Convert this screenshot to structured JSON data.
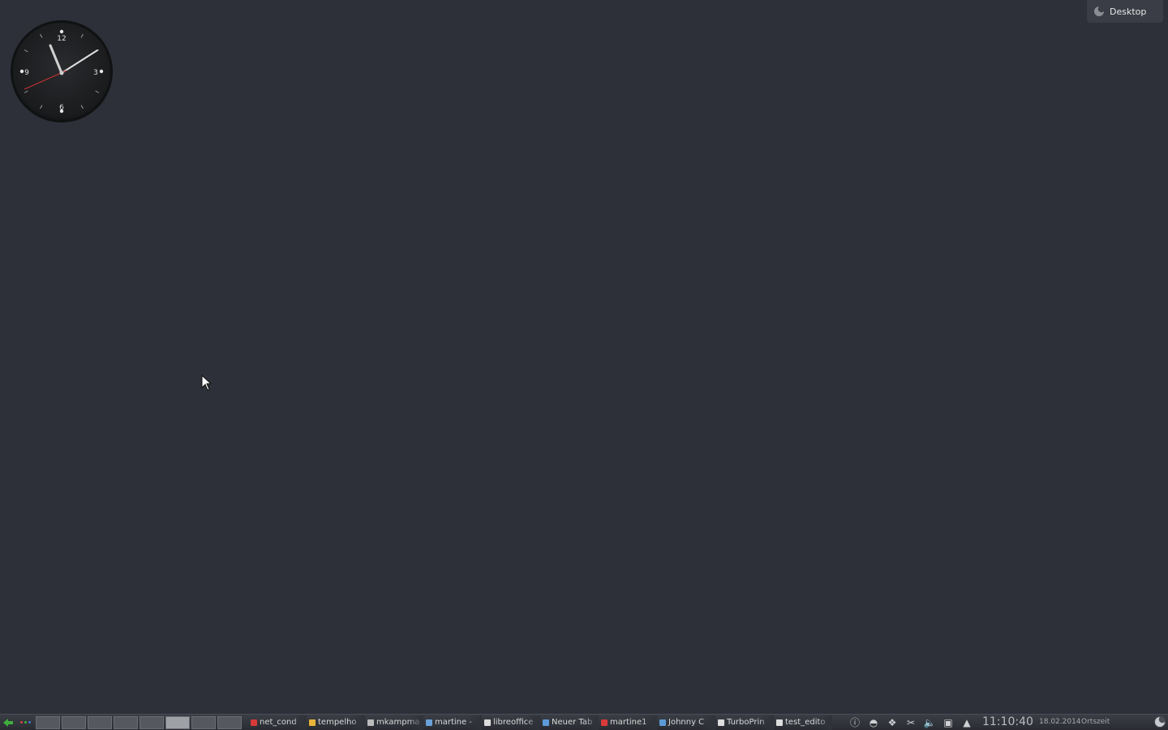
{
  "desktop": {
    "background": "#2d3038"
  },
  "clock_widget": {
    "numerals": [
      "12",
      "3",
      "6",
      "9"
    ],
    "time_shown": "11:10:40"
  },
  "toolbox": {
    "label": "Desktop",
    "icon": "plasma-cashew-icon"
  },
  "panel": {
    "launcher_icon": "kickoff-launcher-icon",
    "activities_icon": "activity-dots-icon",
    "pager": {
      "desktops": [
        "1",
        "2",
        "3",
        "4",
        "5",
        "6",
        "7",
        "8"
      ],
      "current_index": 5
    },
    "tasks": [
      {
        "label": "net_cond",
        "icon": "pdf-icon",
        "color": "#d83a3a"
      },
      {
        "label": "tempelho",
        "icon": "folder-icon",
        "color": "#e8b33a"
      },
      {
        "label": "mkampma",
        "icon": "terminal-icon",
        "color": "#bbbbbb"
      },
      {
        "label": "martine -",
        "icon": "email-icon",
        "color": "#6aa0d8"
      },
      {
        "label": "libreoffice",
        "icon": "document-icon",
        "color": "#dddddd"
      },
      {
        "label": "Neuer Tab",
        "icon": "browser-icon",
        "color": "#5d9bd8"
      },
      {
        "label": "martine1",
        "icon": "pdf-reader-icon",
        "color": "#d83a3a"
      },
      {
        "label": "Johnny C",
        "icon": "chat-icon",
        "color": "#5d9bd8"
      },
      {
        "label": "TurboPrin",
        "icon": "printer-icon",
        "color": "#dddddd"
      },
      {
        "label": "test_edito",
        "icon": "text-editor-icon",
        "color": "#dddddd"
      }
    ],
    "tray": [
      {
        "icon": "info-icon",
        "glyph": "ⓘ"
      },
      {
        "icon": "network-icon",
        "glyph": "◓"
      },
      {
        "icon": "dropbox-icon",
        "glyph": "❖"
      },
      {
        "icon": "scissors-icon",
        "glyph": "✂"
      },
      {
        "icon": "volume-icon",
        "glyph": "🔈"
      },
      {
        "icon": "clipboard-icon",
        "glyph": "▣"
      },
      {
        "icon": "expand-arrow-icon",
        "glyph": "▲"
      }
    ],
    "time": "11:10:40",
    "date": "18.02.2014",
    "timezone": "Ortszeit",
    "cashew_icon": "panel-cashew-icon"
  },
  "colors": {
    "panel_bg": "#33363d",
    "text": "#d8d8d8",
    "clock_second_hand": "#c83232"
  }
}
